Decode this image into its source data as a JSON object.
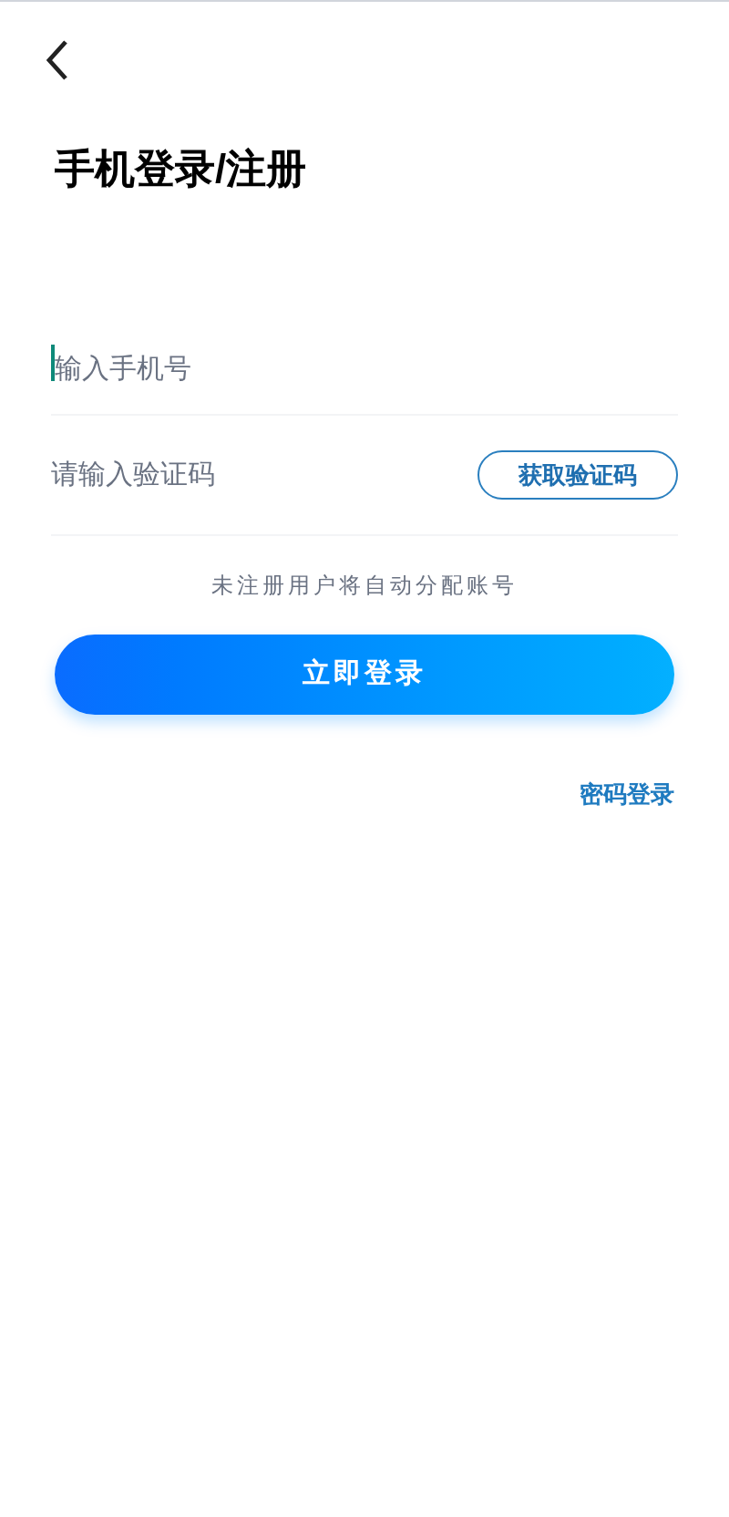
{
  "header": {
    "title": "手机登录/注册"
  },
  "phone_field": {
    "placeholder": "输入手机号",
    "focused": true
  },
  "code_field": {
    "placeholder": "请输入验证码"
  },
  "get_code_button": {
    "label": "获取验证码"
  },
  "hint": "未注册用户将自动分配账号",
  "login_button": {
    "label": "立即登录"
  },
  "password_login_link": {
    "label": "密码登录"
  }
}
